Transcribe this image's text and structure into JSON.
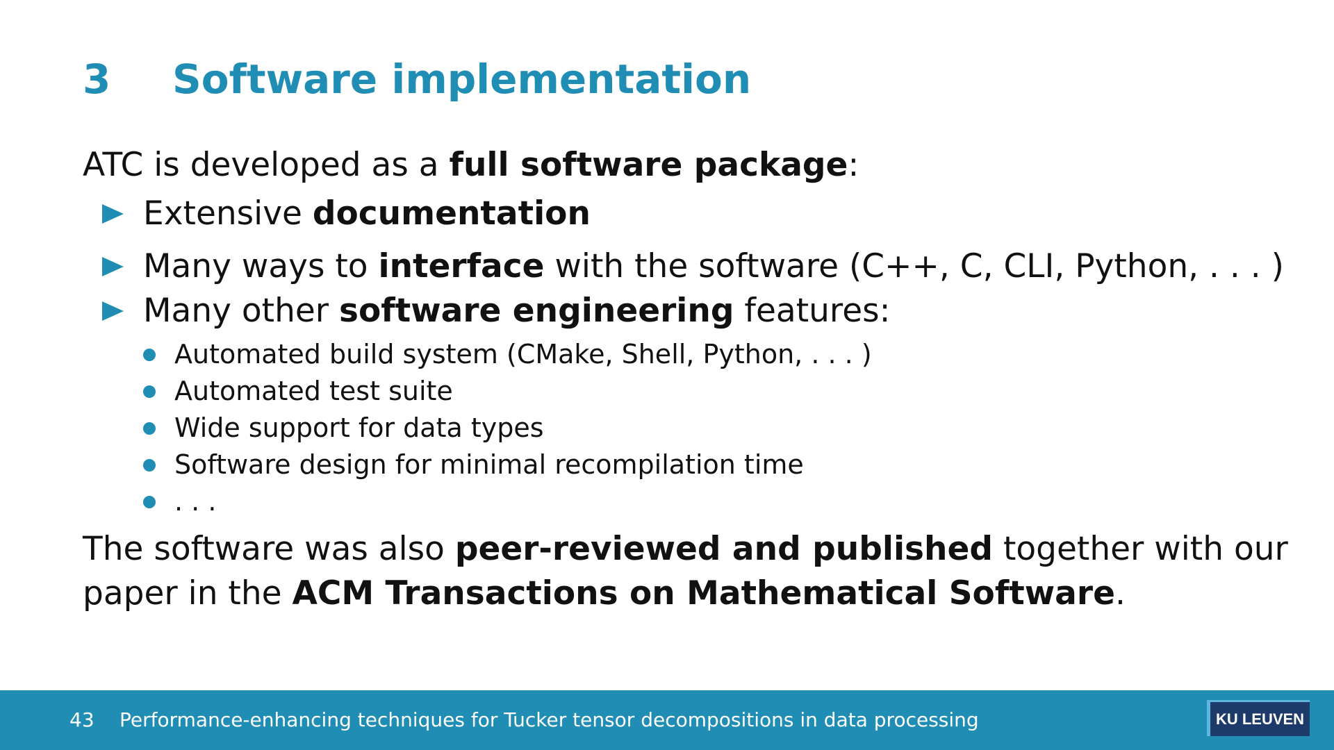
{
  "title": {
    "number": "3",
    "text": "Software implementation"
  },
  "intro": {
    "prefix": "ATC is developed as a ",
    "bold": "full software package",
    "suffix": ":"
  },
  "bullets": [
    {
      "prefix": "Extensive ",
      "bold": "documentation",
      "suffix": ""
    },
    {
      "prefix": "Many ways to ",
      "bold": "interface",
      "suffix": " with the software (C++, C, CLI, Python, . . . )"
    },
    {
      "prefix": "Many other ",
      "bold": "software engineering",
      "suffix": " features:",
      "sub_items": [
        "Automated build system (CMake, Shell, Python, . . . )",
        "Automated test suite",
        "Wide support for data types",
        "Software design for minimal recompilation time",
        ". . ."
      ]
    }
  ],
  "closing": {
    "prefix": "The software was also ",
    "bold1": "peer-reviewed and published",
    "mid": " together with our",
    "mid2": "paper in the ",
    "bold2": "ACM Transactions on Mathematical Software",
    "suffix": "."
  },
  "footer": {
    "page_number": "43",
    "title": "Performance-enhancing techniques for Tucker tensor decompositions in data processing",
    "logo_text": "KU LEUVEN"
  },
  "colors": {
    "accent": "#1f8db4",
    "logo_bg": "#1d3a6a"
  }
}
